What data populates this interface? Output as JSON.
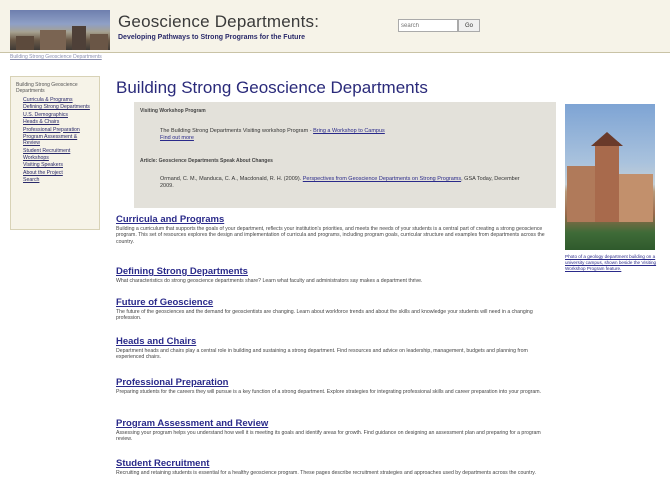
{
  "header": {
    "title": "Geoscience Departments:",
    "subtitle": "Developing Pathways to Strong Programs for the Future",
    "search_placeholder": "search",
    "search_button": "Go",
    "breadcrumb": "Building Strong Geoscience Departments"
  },
  "sidebar": {
    "heading": "Building Strong Geoscience Departments",
    "items": [
      {
        "label": "Curricula & Programs"
      },
      {
        "label": "Defining Strong Departments"
      },
      {
        "label": "U.S. Demographics"
      },
      {
        "label": "Heads & Chairs"
      },
      {
        "label": "Professional Preparation"
      },
      {
        "label": "Program Assessment & Review"
      },
      {
        "label": "Student Recruitment"
      },
      {
        "label": "Workshops"
      },
      {
        "label": "Visiting Speakers"
      },
      {
        "label": "About the Project"
      },
      {
        "label": "Search"
      }
    ]
  },
  "main": {
    "page_title": "Building Strong Geoscience Departments",
    "featured": {
      "label1": "Visiting Workshop Program",
      "text1": "The Building Strong Departments Visiting workshop Program - ",
      "text1_link": "Bring a Workshop to Campus",
      "text1_link2": "Find out more",
      "label2": "Article: Geoscience Departments Speak About Changes",
      "text2": "Ormand, C. M., Manduca, C. A., Macdonald, R. H. (2009). ",
      "text2_link": "Perspectives from Geoscience Departments on Strong Programs",
      "text2_end": ", GSA Today, December 2009."
    },
    "photo_caption": "Photo of a geology department building on a university campus, shown beside the Visiting Workshop Program feature.",
    "sections": [
      {
        "title": "Curricula and Programs",
        "text": "Building a curriculum that supports the goals of your department, reflects your institution's priorities, and meets the needs of your students is a central part of creating a strong geoscience program. This set of resources explores the design and implementation of curricula and programs, including program goals, curricular structure and examples from departments across the country."
      },
      {
        "title": "Defining Strong Departments",
        "text": "What characteristics do strong geoscience departments share? Learn what faculty and administrators say makes a department thrive."
      },
      {
        "title": "Future of Geoscience",
        "text": "The future of the geosciences and the demand for geoscientists are changing. Learn about workforce trends and about the skills and knowledge your students will need in a changing profession."
      },
      {
        "title": "Heads and Chairs",
        "text": "Department heads and chairs play a central role in building and sustaining a strong department. Find resources and advice on leadership, management, budgets and planning from experienced chairs."
      },
      {
        "title": "Professional Preparation",
        "text": "Preparing students for the careers they will pursue is a key function of a strong department. Explore strategies for integrating professional skills and career preparation into your program."
      },
      {
        "title": "Program Assessment and Review",
        "text": "Assessing your program helps you understand how well it is meeting its goals and identify areas for growth. Find guidance on designing an assessment plan and preparing for a program review."
      },
      {
        "title": "Student Recruitment",
        "text": "Recruiting and retaining students is essential for a healthy geoscience program. These pages describe recruitment strategies and approaches used by departments across the country."
      }
    ]
  }
}
